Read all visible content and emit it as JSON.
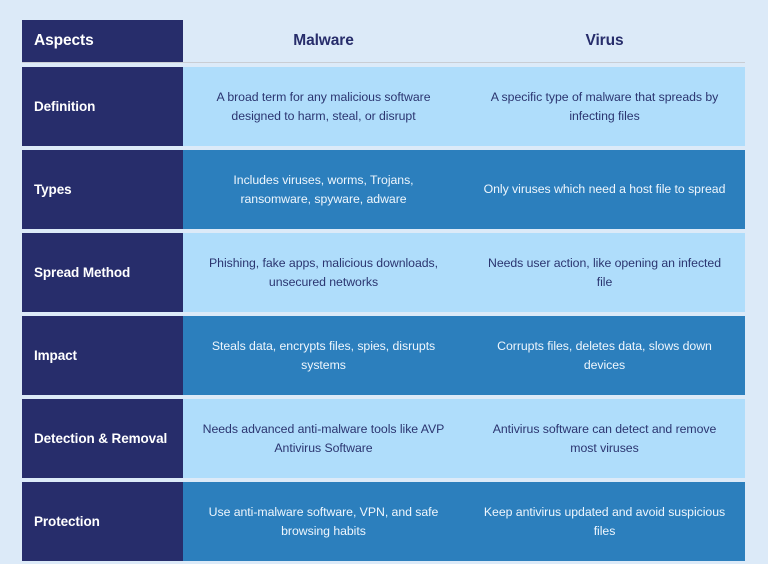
{
  "table": {
    "header": {
      "aspects_label": "Aspects",
      "columns": [
        "Malware",
        "Virus"
      ]
    },
    "rows": [
      {
        "label": "Definition",
        "tone": "light",
        "malware": "A broad term for any malicious software designed to harm, steal, or disrupt",
        "virus": "A specific type of malware that spreads by infecting files"
      },
      {
        "label": "Types",
        "tone": "dark",
        "malware": "Includes viruses, worms, Trojans, ransomware, spyware, adware",
        "virus": "Only viruses which need a host file to spread"
      },
      {
        "label": "Spread Method",
        "tone": "light",
        "malware": "Phishing, fake apps, malicious downloads, unsecured networks",
        "virus": "Needs user action, like opening an infected file"
      },
      {
        "label": "Impact",
        "tone": "dark",
        "malware": "Steals data, encrypts files, spies, disrupts systems",
        "virus": "Corrupts files, deletes data, slows down devices"
      },
      {
        "label": "Detection & Removal",
        "tone": "light",
        "malware": "Needs advanced anti-malware tools like AVP Antivirus Software",
        "virus": "Antivirus software can detect and remove most viruses"
      },
      {
        "label": "Protection",
        "tone": "dark",
        "malware": "Use anti-malware software, VPN, and safe browsing habits",
        "virus": "Keep antivirus updated and avoid suspicious files"
      }
    ]
  },
  "colors": {
    "page_background": "#DCEAF8",
    "navy": "#272D6B",
    "light_blue_cell": "#AFDDFB",
    "medium_blue_cell": "#2C7FBD",
    "header_divider": "#C9CDD4"
  }
}
